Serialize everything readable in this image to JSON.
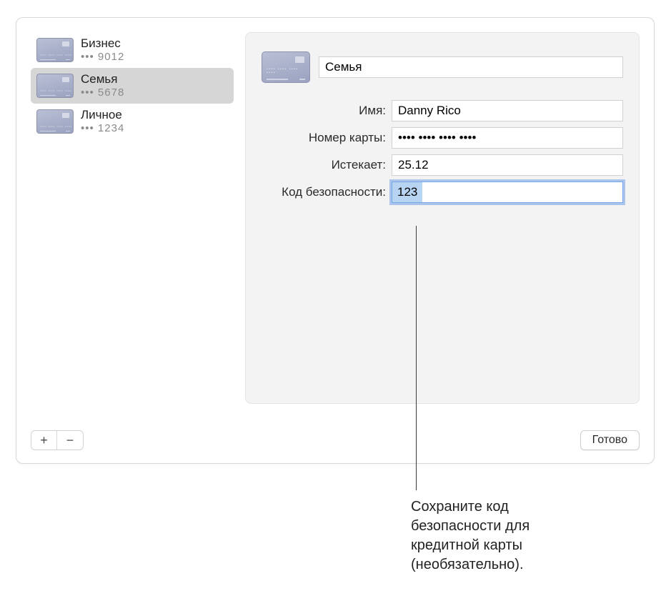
{
  "sidebar": {
    "cards": [
      {
        "name": "Бизнес",
        "last4": "••• 9012",
        "selected": false
      },
      {
        "name": "Семья",
        "last4": "••• 5678",
        "selected": true
      },
      {
        "name": "Личное",
        "last4": "••• 1234",
        "selected": false
      }
    ]
  },
  "detail": {
    "title": "Семья",
    "labels": {
      "name": "Имя:",
      "card_number": "Номер карты:",
      "expires": "Истекает:",
      "security_code": "Код безопасности:"
    },
    "values": {
      "name": "Danny Rico",
      "card_number": "•••• •••• •••• ••••",
      "expires": "25.12",
      "security_code": "123"
    }
  },
  "buttons": {
    "add": "+",
    "remove": "−",
    "done": "Готово"
  },
  "callout": "Сохраните код безопасности для кредитной карты (необязательно)."
}
